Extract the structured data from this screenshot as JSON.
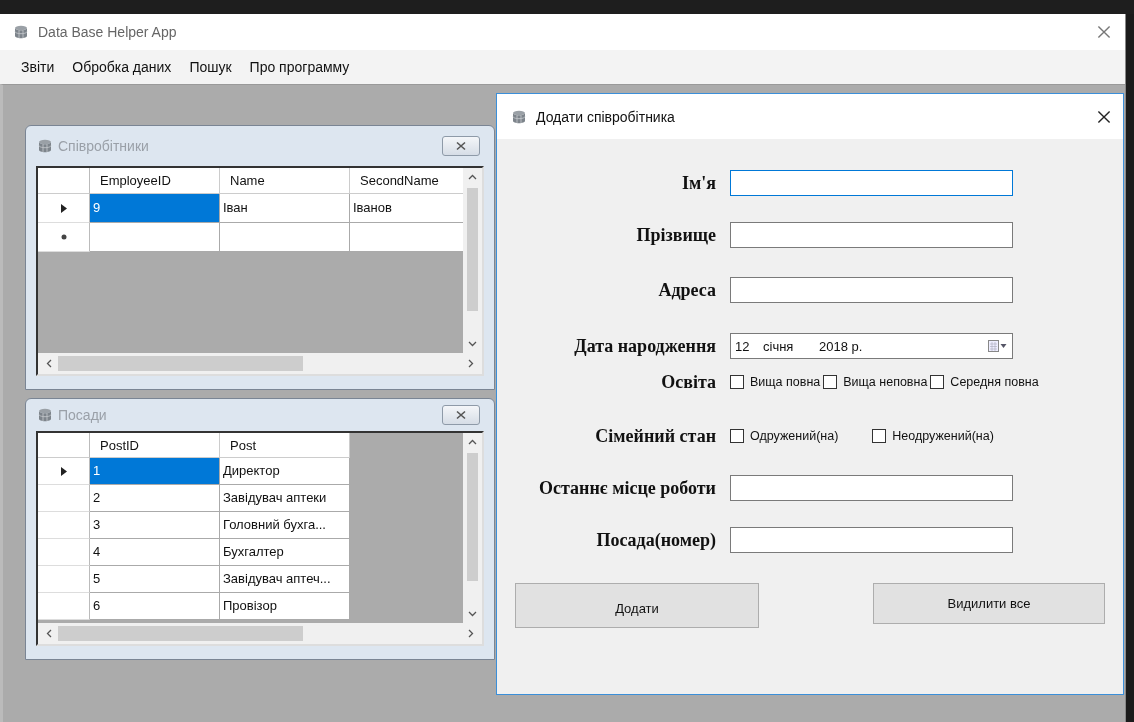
{
  "window": {
    "title": "Data Base Helper App"
  },
  "menu": [
    {
      "label": "Звіти"
    },
    {
      "label": "Обробка даних"
    },
    {
      "label": "Пошук"
    },
    {
      "label": "Про программу"
    }
  ],
  "child_windows": [
    {
      "title": "Співробітники",
      "columns": [
        "EmployeeID",
        "Name",
        "SecondName"
      ],
      "rows": [
        {
          "kind": "data",
          "selected": true,
          "cells": [
            "9",
            "Іван",
            "Іванов"
          ]
        },
        {
          "kind": "new",
          "selected": false,
          "cells": []
        }
      ]
    },
    {
      "title": "Посади",
      "columns": [
        "PostID",
        "Post"
      ],
      "rows": [
        {
          "kind": "data",
          "selected": true,
          "cells": [
            "1",
            "Директор"
          ]
        },
        {
          "kind": "data",
          "selected": false,
          "cells": [
            "2",
            "Завідувач аптеки"
          ]
        },
        {
          "kind": "data",
          "selected": false,
          "cells": [
            "3",
            "Головний бухга..."
          ]
        },
        {
          "kind": "data",
          "selected": false,
          "cells": [
            "4",
            "Бухгалтер"
          ]
        },
        {
          "kind": "data",
          "selected": false,
          "cells": [
            "5",
            "Завідувач аптеч..."
          ]
        },
        {
          "kind": "data",
          "selected": false,
          "cells": [
            "6",
            "Провізор"
          ]
        }
      ]
    }
  ],
  "dialog": {
    "title": "Додати співробітника",
    "fields": [
      {
        "kind": "text",
        "label": "Ім'я",
        "focused": true
      },
      {
        "kind": "text",
        "label": "Прізвище",
        "focused": false
      },
      {
        "kind": "text",
        "label": "Адреса",
        "focused": false
      },
      {
        "kind": "date",
        "label": "Дата народження",
        "day": "12",
        "month": "січня",
        "year": "2018 р."
      },
      {
        "kind": "checks",
        "label": "Освіта",
        "options": [
          {
            "label": "Вища повна",
            "checked": false
          },
          {
            "label": "Вища неповна",
            "checked": false
          },
          {
            "label": "Середня повна",
            "checked": false
          }
        ]
      },
      {
        "kind": "checks",
        "label": "Сімейний стан",
        "options": [
          {
            "label": "Одружений(на)",
            "checked": false
          },
          {
            "label": "Неодружений(на)",
            "checked": false
          }
        ]
      },
      {
        "kind": "text",
        "label": "Останнє місце роботи",
        "focused": false
      },
      {
        "kind": "text",
        "label": "Посада(номер)",
        "focused": false
      }
    ],
    "buttons": [
      "Додати",
      "Видилити все"
    ]
  }
}
